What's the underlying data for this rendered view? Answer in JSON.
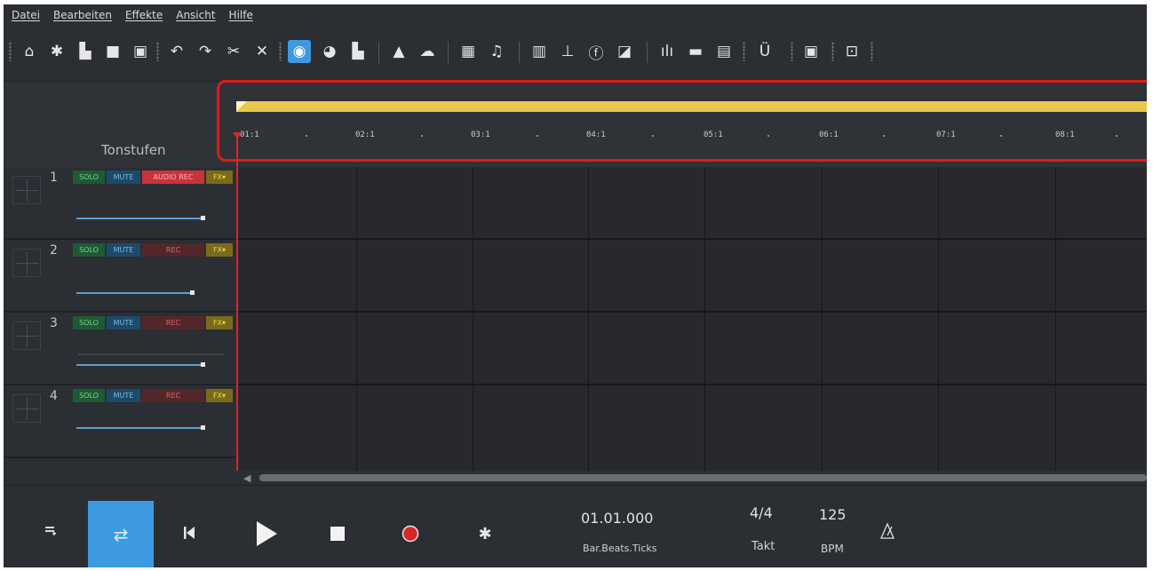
{
  "menu": [
    "Datei",
    "Bearbeiten",
    "Effekte",
    "Ansicht",
    "Hilfe"
  ],
  "toolbar": {
    "icons": [
      "home-icon",
      "gear-icon",
      "new-file-icon",
      "open-folder-icon",
      "save-icon",
      "undo-icon",
      "redo-icon",
      "cut-icon",
      "delete-icon",
      "stereo-icon",
      "disc-icon",
      "folder-icon",
      "shop-bag-icon",
      "cloud-upload-icon",
      "grid-icon",
      "note-icon",
      "piano-icon",
      "mixer-icon",
      "fx-icon",
      "mastering-icon",
      "equalizer-icon",
      "video-icon",
      "split-icon",
      "voice-icon",
      "fullscreen-icon",
      "minimize-icon"
    ],
    "glyphs": [
      "⌂",
      "✱",
      "▙",
      "■",
      "▣",
      "↶",
      "↷",
      "✂",
      "✕",
      "◉",
      "◕",
      "▙",
      "▲",
      "☁",
      "▦",
      "♫",
      "▥",
      "⊥",
      "ⓕ",
      "◪",
      "ılı",
      "▬",
      "▤",
      "Ü",
      "▣",
      "⊡"
    ]
  },
  "tracks_header": {
    "title": "Tonstufen"
  },
  "ruler": {
    "labels": [
      "01:1",
      "02:1",
      "03:1",
      "04:1",
      "05:1",
      "06:1",
      "07:1",
      "08:1"
    ]
  },
  "tracks": [
    {
      "number": "1",
      "solo": "SOLO",
      "mute": "MUTE",
      "rec": "AUDIO REC",
      "rec_active": true,
      "fx": "FX▾",
      "volume": 0.88
    },
    {
      "number": "2",
      "solo": "SOLO",
      "mute": "MUTE",
      "rec": "REC",
      "rec_active": false,
      "fx": "FX▾",
      "volume": 0.81
    },
    {
      "number": "3",
      "solo": "SOLO",
      "mute": "MUTE",
      "rec": "REC",
      "rec_active": false,
      "fx": "FX▾",
      "volume": 0.88
    },
    {
      "number": "4",
      "solo": "SOLO",
      "mute": "MUTE",
      "rec": "REC",
      "rec_active": false,
      "fx": "FX▾",
      "volume": 0.88
    }
  ],
  "transport": {
    "position": "01.01.000",
    "position_label": "Bar.Beats.Ticks",
    "time_signature": "4/4",
    "time_signature_label": "Takt",
    "tempo": "125",
    "tempo_label": "BPM"
  },
  "colors": {
    "accent": "#3d9ae0",
    "record": "#d8262a",
    "loop": "#e9c84b",
    "highlight": "#e01b1b"
  }
}
